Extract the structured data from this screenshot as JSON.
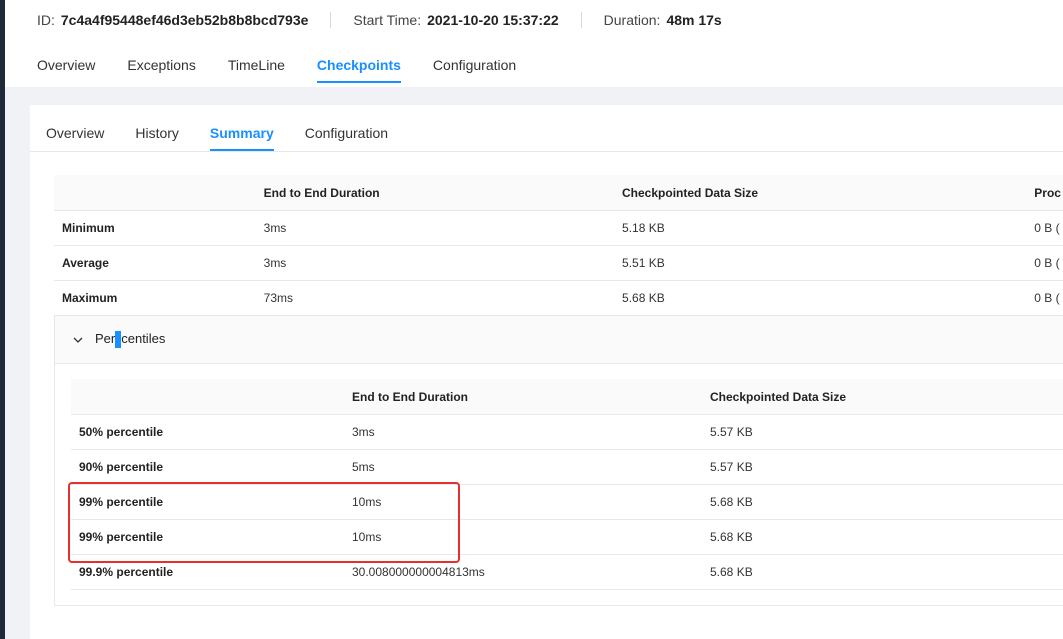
{
  "job": {
    "id_label": "ID:",
    "id_value": "7c4a4f95448ef46d3eb52b8b8bcd793e",
    "start_label": "Start Time:",
    "start_value": "2021-10-20 15:37:22",
    "duration_label": "Duration:",
    "duration_value": "48m 17s"
  },
  "top_tabs": [
    "Overview",
    "Exceptions",
    "TimeLine",
    "Checkpoints",
    "Configuration"
  ],
  "sub_tabs": [
    "Overview",
    "History",
    "Summary",
    "Configuration"
  ],
  "summary": {
    "headers": [
      "",
      "End to End Duration",
      "Checkpointed Data Size",
      "Proc"
    ],
    "rows": [
      [
        "Minimum",
        "3ms",
        "5.18 KB",
        "0 B ("
      ],
      [
        "Average",
        "3ms",
        "5.51 KB",
        "0 B ("
      ],
      [
        "Maximum",
        "73ms",
        "5.68 KB",
        "0 B ("
      ]
    ]
  },
  "percentiles": {
    "title_part1": "Per",
    "title_part2": "centiles",
    "headers": [
      "",
      "End to End Duration",
      "Checkpointed Data Size"
    ],
    "rows": [
      [
        "50% percentile",
        "3ms",
        "5.57 KB"
      ],
      [
        "90% percentile",
        "5ms",
        "5.57 KB"
      ],
      [
        "99% percentile",
        "10ms",
        "5.68 KB"
      ],
      [
        "99% percentile",
        "10ms",
        "5.68 KB"
      ],
      [
        "99.9% percentile",
        "30.008000000004813ms",
        "5.68 KB"
      ]
    ]
  },
  "colors": {
    "accent": "#1890ff",
    "highlight": "#e53030"
  }
}
